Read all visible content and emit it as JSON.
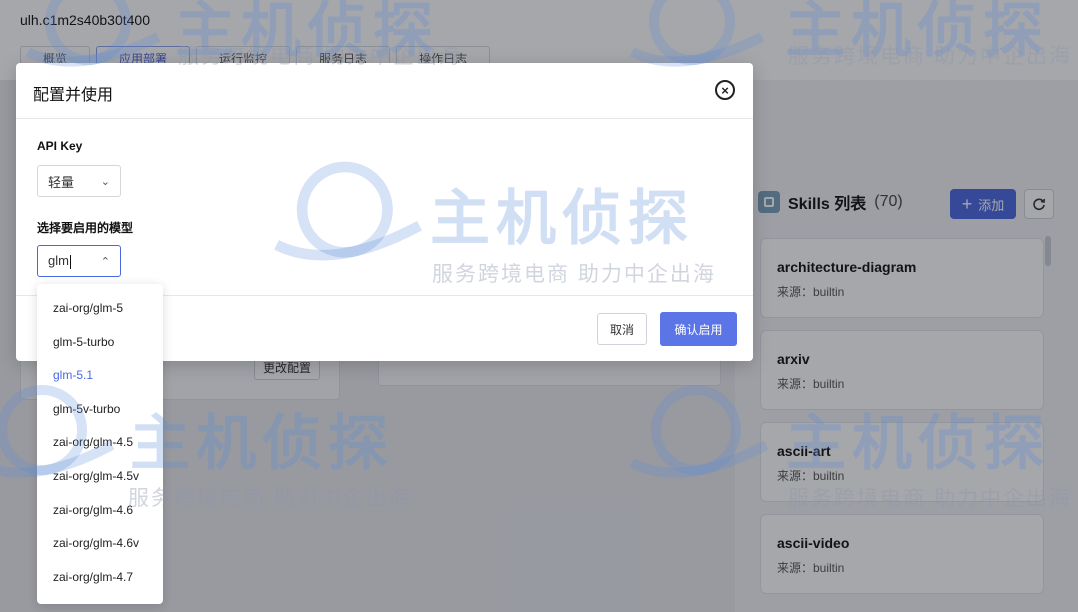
{
  "background": {
    "host": "ulh.c1m2s40b30t400",
    "tabs": [
      "概览",
      "应用部署",
      "运行监控",
      "服务日志",
      "操作日志"
    ],
    "change_config_label": "更改配置",
    "skills": {
      "title": "Skills 列表",
      "count": "(70)",
      "add_label": "添加",
      "items": [
        {
          "name": "architecture-diagram",
          "source": "来源：builtin"
        },
        {
          "name": "arxiv",
          "source": "来源：builtin"
        },
        {
          "name": "ascii-art",
          "source": "来源：builtin"
        },
        {
          "name": "ascii-video",
          "source": "来源：builtin"
        }
      ]
    }
  },
  "modal": {
    "title": "配置并使用",
    "api_key_label": "API Key",
    "api_key_value": "轻量",
    "model_label": "选择要启用的模型",
    "model_input_value": "glm",
    "cancel_label": "取消",
    "confirm_label": "确认启用"
  },
  "dropdown": {
    "options": [
      {
        "label": "zai-org/glm-5",
        "selected": false
      },
      {
        "label": "glm-5-turbo",
        "selected": false
      },
      {
        "label": "glm-5.1",
        "selected": true
      },
      {
        "label": "glm-5v-turbo",
        "selected": false
      },
      {
        "label": "zai-org/glm-4.5",
        "selected": false
      },
      {
        "label": "zai-org/glm-4.5v",
        "selected": false
      },
      {
        "label": "zai-org/glm-4.6",
        "selected": false
      },
      {
        "label": "zai-org/glm-4.6v",
        "selected": false
      },
      {
        "label": "zai-org/glm-4.7",
        "selected": false
      }
    ]
  },
  "watermark": {
    "brand": "主机侦探",
    "slogan": "服务跨境电商 助力中企出海"
  },
  "colors": {
    "accent": "#4a68e0",
    "confirm": "#5b74e6"
  }
}
